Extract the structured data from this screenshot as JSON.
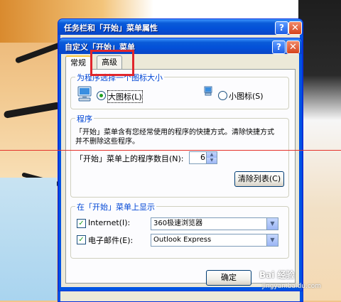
{
  "outer_window": {
    "title": "任务栏和「开始」菜单属性",
    "help": "?",
    "close": "✕"
  },
  "dialog": {
    "title": "自定义「开始」菜单",
    "help": "?",
    "close": "✕"
  },
  "tabs": [
    {
      "label": "常规",
      "active": true
    },
    {
      "label": "高级",
      "active": false
    }
  ],
  "icon_size": {
    "legend": "为程序选择一个图标大小",
    "large_label": "大图标(L)",
    "small_label": "小图标(S)",
    "selected": "large"
  },
  "programs": {
    "legend": "程序",
    "description_line1": "「开始」菜单含有您经常使用的程序的快捷方式。清除快捷方式",
    "description_line2": "并不删除这些程序。",
    "count_label": "「开始」菜单上的程序数目(N):",
    "count_value": "6",
    "clear_button": "清除列表(C)"
  },
  "show_on_start": {
    "legend": "在「开始」菜单上显示",
    "items": [
      {
        "label": "Internet(I):",
        "checked": true,
        "value": "360极速浏览器"
      },
      {
        "label": "电子邮件(E):",
        "checked": true,
        "value": "Outlook Express"
      }
    ]
  },
  "ok_button": "确定",
  "watermark": {
    "line1": "Bai 经验",
    "line2": "jingyan.baidu.com"
  },
  "colors": {
    "titlebar": "#0350d8",
    "face": "#ece9d8",
    "highlight": "#e0262c",
    "legend": "#0046d5"
  }
}
